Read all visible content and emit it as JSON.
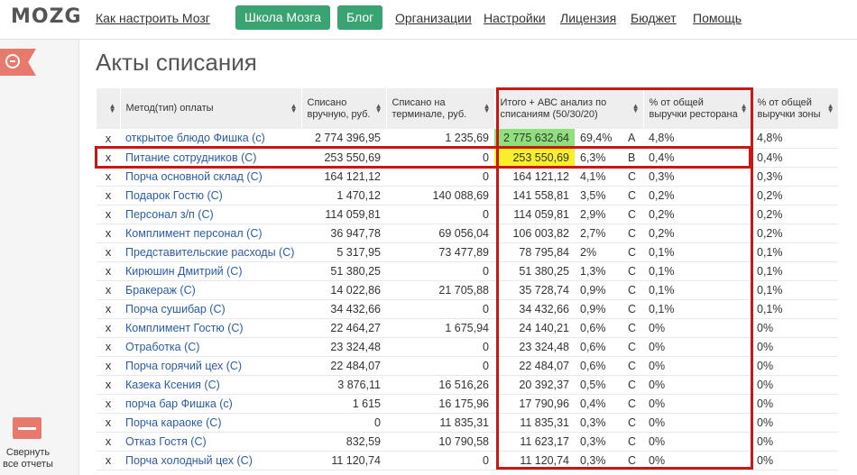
{
  "header": {
    "logo": "MOZG",
    "nav": {
      "how_to": "Как настроить Мозг",
      "school": "Школа Мозга",
      "blog": "Блог",
      "orgs": "Организации",
      "settings": "Настройки",
      "license": "Лицензия",
      "budget": "Бюджет",
      "help": "Помощь"
    }
  },
  "sidebar": {
    "collapse_label": "Свернуть все отчеты"
  },
  "page": {
    "title": "Акты списания"
  },
  "table": {
    "headers": {
      "method": "Метод(тип) оплаты",
      "manual": "Списано вручную, руб.",
      "terminal": "Списано на терминале, руб.",
      "total_abc": "Итого + АВС анализ по списаниям (50/30/20)",
      "pct_restaurant": "% от общей выручки ресторана",
      "pct_zone": "% от общей выручки зоны"
    },
    "rows": [
      {
        "x": "x",
        "name": "открытое блюдо Фишка (с)",
        "manual": "2 774 396,95",
        "terminal": "1 235,69",
        "total": "2 775 632,64",
        "share": "69,4%",
        "abc": "A",
        "pct_r": "4,8%",
        "pct_z": "4,8%"
      },
      {
        "x": "x",
        "name": "Питание сотрудников (С)",
        "manual": "253 550,69",
        "terminal": "0",
        "total": "253 550,69",
        "share": "6,3%",
        "abc": "B",
        "pct_r": "0,4%",
        "pct_z": "0,4%"
      },
      {
        "x": "x",
        "name": "Порча основной склад (С)",
        "manual": "164 121,12",
        "terminal": "0",
        "total": "164 121,12",
        "share": "4,1%",
        "abc": "C",
        "pct_r": "0,3%",
        "pct_z": "0,3%"
      },
      {
        "x": "x",
        "name": "Подарок Гостю (С)",
        "manual": "1 470,12",
        "terminal": "140 088,69",
        "total": "141 558,81",
        "share": "3,5%",
        "abc": "C",
        "pct_r": "0,2%",
        "pct_z": "0,2%"
      },
      {
        "x": "x",
        "name": "Персонал з/п (С)",
        "manual": "114 059,81",
        "terminal": "0",
        "total": "114 059,81",
        "share": "2,9%",
        "abc": "C",
        "pct_r": "0,2%",
        "pct_z": "0,2%"
      },
      {
        "x": "x",
        "name": "Комплимент персонал (С)",
        "manual": "36 947,78",
        "terminal": "69 056,04",
        "total": "106 003,82",
        "share": "2,7%",
        "abc": "C",
        "pct_r": "0,2%",
        "pct_z": "0,2%"
      },
      {
        "x": "x",
        "name": "Представительские расходы (С)",
        "manual": "5 317,95",
        "terminal": "73 477,89",
        "total": "78 795,84",
        "share": "2%",
        "abc": "C",
        "pct_r": "0,1%",
        "pct_z": "0,1%"
      },
      {
        "x": "x",
        "name": "Кирюшин Дмитрий (С)",
        "manual": "51 380,25",
        "terminal": "0",
        "total": "51 380,25",
        "share": "1,3%",
        "abc": "C",
        "pct_r": "0,1%",
        "pct_z": "0,1%"
      },
      {
        "x": "x",
        "name": "Бракераж (С)",
        "manual": "14 022,86",
        "terminal": "21 705,88",
        "total": "35 728,74",
        "share": "0,9%",
        "abc": "C",
        "pct_r": "0,1%",
        "pct_z": "0,1%"
      },
      {
        "x": "x",
        "name": "Порча сушибар (С)",
        "manual": "34 432,66",
        "terminal": "0",
        "total": "34 432,66",
        "share": "0,9%",
        "abc": "C",
        "pct_r": "0,1%",
        "pct_z": "0,1%"
      },
      {
        "x": "x",
        "name": "Комплимент Гостю (С)",
        "manual": "22 464,27",
        "terminal": "1 675,94",
        "total": "24 140,21",
        "share": "0,6%",
        "abc": "C",
        "pct_r": "0%",
        "pct_z": "0%"
      },
      {
        "x": "x",
        "name": "Отработка (С)",
        "manual": "23 324,48",
        "terminal": "0",
        "total": "23 324,48",
        "share": "0,6%",
        "abc": "C",
        "pct_r": "0%",
        "pct_z": "0%"
      },
      {
        "x": "x",
        "name": "Порча горячий цех (С)",
        "manual": "22 484,07",
        "terminal": "0",
        "total": "22 484,07",
        "share": "0,6%",
        "abc": "C",
        "pct_r": "0%",
        "pct_z": "0%"
      },
      {
        "x": "x",
        "name": "Казека Ксения (С)",
        "manual": "3 876,11",
        "terminal": "16 516,26",
        "total": "20 392,37",
        "share": "0,5%",
        "abc": "C",
        "pct_r": "0%",
        "pct_z": "0%"
      },
      {
        "x": "x",
        "name": "порча бар Фишка (с)",
        "manual": "1 615",
        "terminal": "16 175,96",
        "total": "17 790,96",
        "share": "0,4%",
        "abc": "C",
        "pct_r": "0%",
        "pct_z": "0%"
      },
      {
        "x": "x",
        "name": "Порча караоке (С)",
        "manual": "0",
        "terminal": "11 835,31",
        "total": "11 835,31",
        "share": "0,3%",
        "abc": "C",
        "pct_r": "0%",
        "pct_z": "0%"
      },
      {
        "x": "x",
        "name": "Отказ Гостя (С)",
        "manual": "832,59",
        "terminal": "10 790,58",
        "total": "11 623,17",
        "share": "0,3%",
        "abc": "C",
        "pct_r": "0%",
        "pct_z": "0%"
      },
      {
        "x": "x",
        "name": "Порча холодный цех (С)",
        "manual": "11 120,74",
        "terminal": "0",
        "total": "11 120,74",
        "share": "0,3%",
        "abc": "C",
        "pct_r": "0%",
        "pct_z": "0%"
      }
    ]
  },
  "colors": {
    "accent_green": "#3aa372",
    "highlight_green": "#8fe07a",
    "highlight_yellow": "#f7ef2a",
    "annotation_red": "#c91616",
    "link_blue": "#2a5ca8"
  }
}
